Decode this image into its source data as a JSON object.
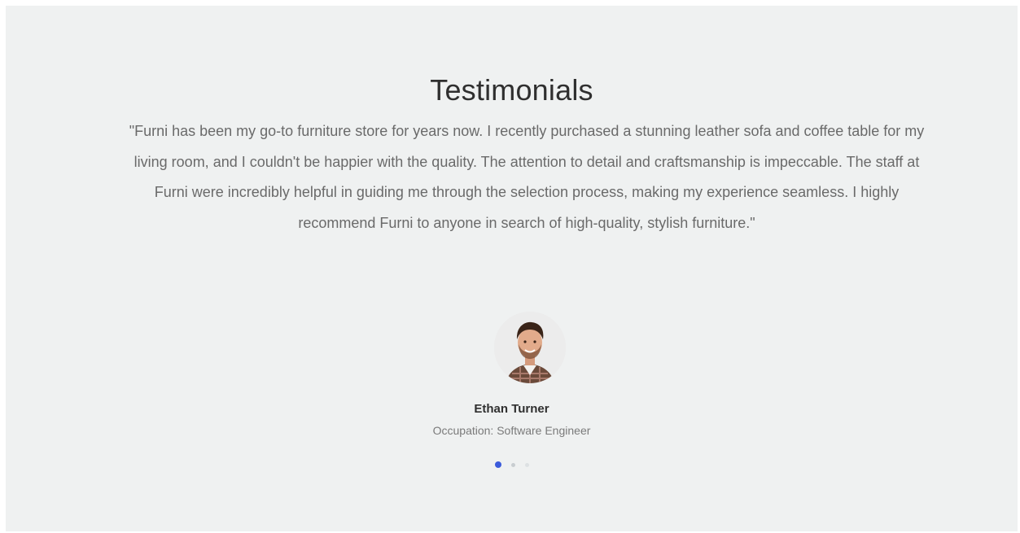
{
  "testimonials": {
    "title": "Testimonials",
    "quote": "\"Furni has been my go-to furniture store for years now. I recently purchased a stunning leather sofa and coffee table for my living room, and I couldn't be happier with the quality. The attention to detail and craftsmanship is impeccable. The staff at Furni were incredibly helpful in guiding me through the selection process, making my experience seamless. I highly recommend Furni to anyone in search of high-quality, stylish furniture.\"",
    "author": {
      "name": "Ethan Turner",
      "occupation": "Occupation: Software Engineer",
      "avatar_icon": "person-portrait"
    },
    "carousel": {
      "slide_count": 3,
      "active_index": 0,
      "active_color": "#3b5bdb",
      "inactive_color": "#c8cdd0"
    }
  }
}
